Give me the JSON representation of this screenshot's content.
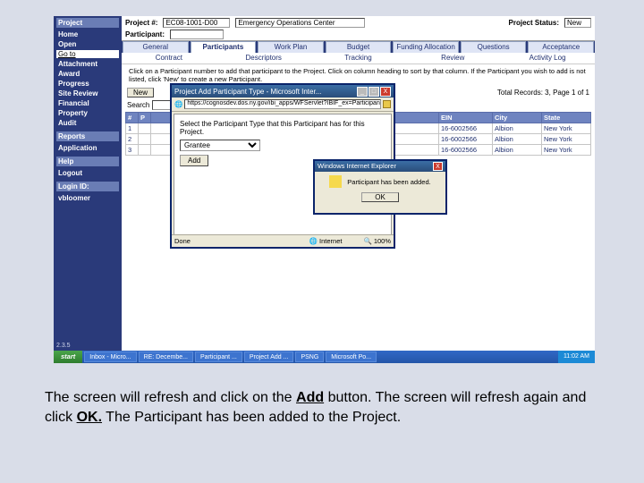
{
  "header": {
    "project_no_label": "Project #:",
    "project_no": "EC08-1001-D00",
    "project_name": "Emergency Operations Center",
    "status_label": "Project Status:",
    "status": "New",
    "participant_label": "Participant:"
  },
  "sidebar": {
    "title": "Project",
    "home": "Home",
    "open": "Open",
    "goto": "Go to",
    "items": [
      "Attachment",
      "Award",
      "Progress",
      "Site Review",
      "Financial",
      "Property",
      "Audit"
    ],
    "section2": "Reports",
    "section2b": "Application",
    "help": "Help",
    "logout": "Logout",
    "login_label": "Login ID:",
    "login_id": "vbloomer",
    "version": "2.3.5"
  },
  "tabs": {
    "row1": [
      "General",
      "Participants",
      "Work Plan",
      "Budget",
      "Funding Allocation",
      "Questions",
      "Acceptance"
    ],
    "active_index": 1,
    "row2": [
      "Contract",
      "Descriptors",
      "Tracking",
      "Review",
      "Activity Log"
    ]
  },
  "instruction": "Click on a Participant number to add that participant to the Project. Click on column heading to sort by that column. If the Participant you wish to add is not listed, click 'New' to create a new Participant.",
  "pager": {
    "new": "New",
    "records": "Total Records: 3, Page 1 of 1"
  },
  "search": {
    "label": "Search"
  },
  "table": {
    "headers": [
      "#",
      "P",
      "",
      "",
      "",
      "EIN",
      "City",
      "State"
    ],
    "rows": [
      {
        "n": "1",
        "ein": "16-6002566",
        "city": "Albion",
        "state": "New York"
      },
      {
        "n": "2",
        "ein": "16-6002566",
        "city": "Albion",
        "state": "New York"
      },
      {
        "n": "3",
        "ein": "16-6002566",
        "city": "Albion",
        "state": "New York"
      }
    ]
  },
  "popup": {
    "title": "Project Add Participant Type - Microsoft Inter...",
    "url": "https://cognosdev.dos.ny.gov/ibi_apps/WFServlet?IBIF_ex=Participant",
    "body_text": "Select the Participant Type that this Participant has for this Project.",
    "option": "Grantee",
    "add": "Add",
    "status_done": "Done",
    "status_net": "Internet",
    "zoom": "100%"
  },
  "alert": {
    "title": "Windows Internet Explorer",
    "msg": "Participant has been added.",
    "ok": "OK"
  },
  "taskbar": {
    "start": "start",
    "items": [
      "Inbox - Micro...",
      "RE: Decembe...",
      "Participant ...",
      "Project Add ...",
      "PSNG",
      "Microsoft Po..."
    ],
    "time": "11:02 AM"
  },
  "caption": {
    "p1a": "The screen will refresh and click on the ",
    "p1b": "Add",
    "p1c": " button.  The screen will refresh again and click ",
    "p1d": "OK.",
    "p1e": "  The Participant has been added to the Project."
  }
}
